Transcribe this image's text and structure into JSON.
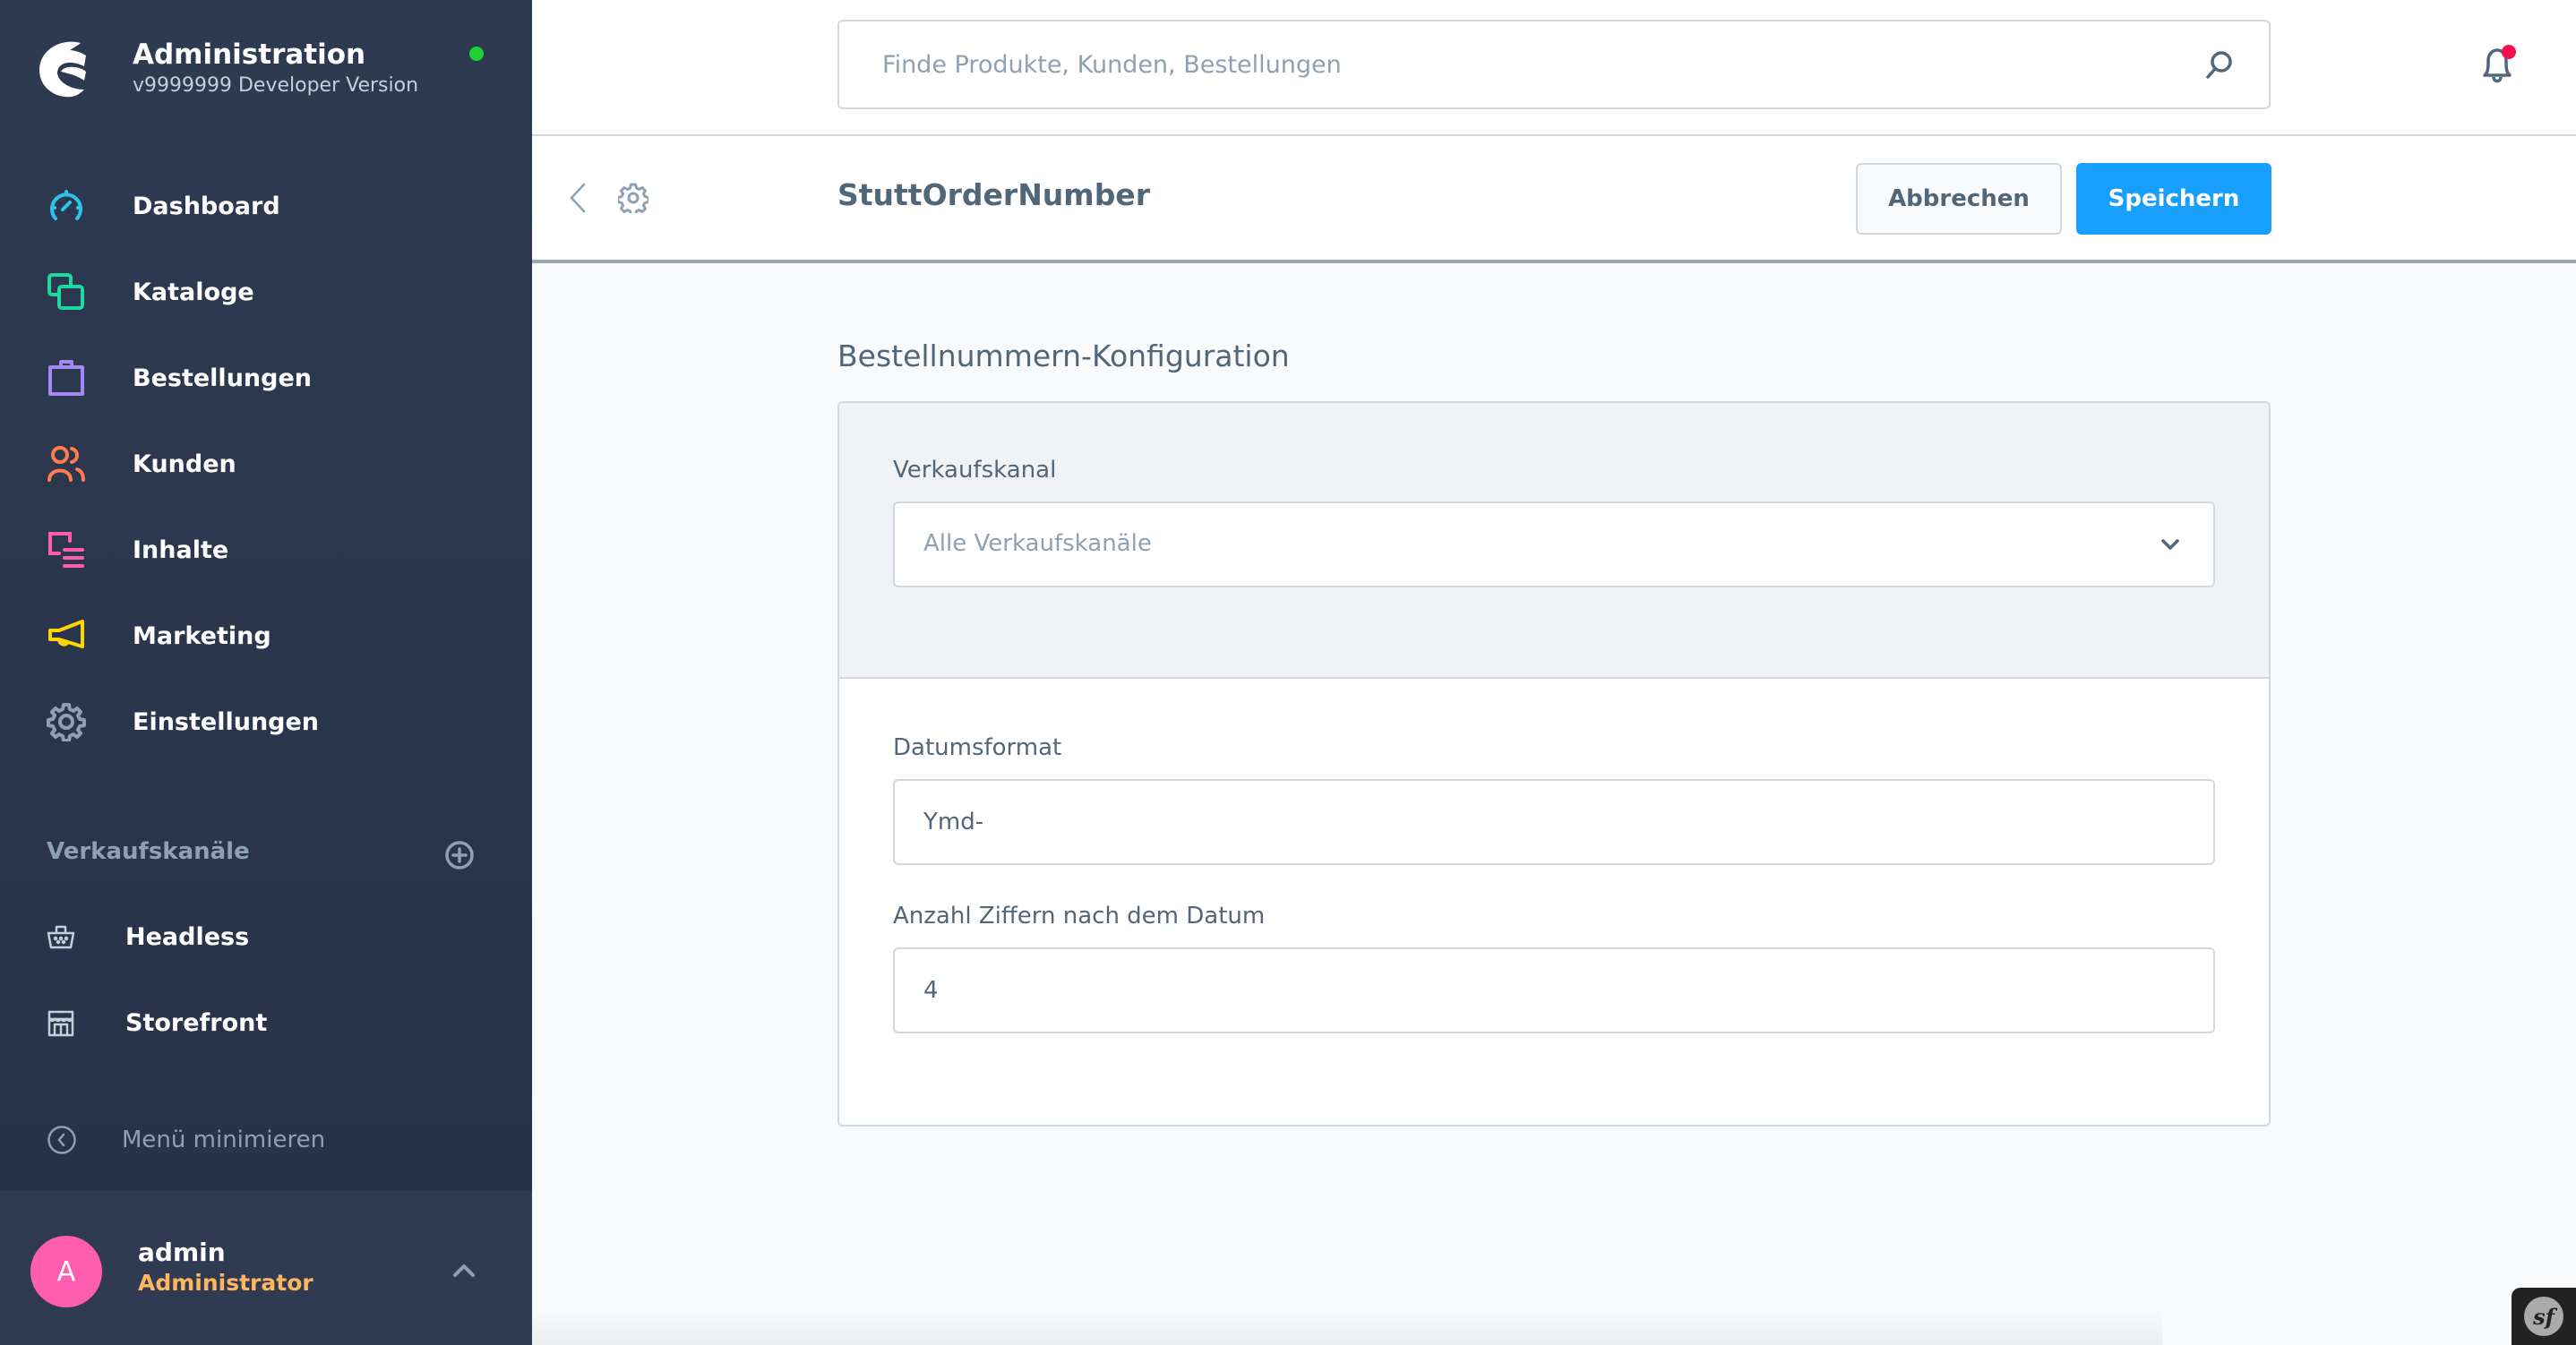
{
  "brand": {
    "title": "Administration",
    "version": "v9999999 Developer Version",
    "status_color": "#1ed236"
  },
  "sidebar": {
    "items": [
      {
        "label": "Dashboard",
        "icon": "dashboard-icon",
        "color": "#2bc5e8"
      },
      {
        "label": "Kataloge",
        "icon": "catalog-icon",
        "color": "#1fd8a0"
      },
      {
        "label": "Bestellungen",
        "icon": "orders-bag-icon",
        "color": "#a287f5"
      },
      {
        "label": "Kunden",
        "icon": "customers-icon",
        "color": "#ff7d4d"
      },
      {
        "label": "Inhalte",
        "icon": "content-icon",
        "color": "#ff5db0"
      },
      {
        "label": "Marketing",
        "icon": "megaphone-icon",
        "color": "#ffd700"
      },
      {
        "label": "Einstellungen",
        "icon": "gear-icon",
        "color": "#8ea0b3"
      }
    ],
    "sales_channels_title": "Verkaufskanäle",
    "sales_channels": [
      {
        "label": "Headless",
        "icon": "basket-icon"
      },
      {
        "label": "Storefront",
        "icon": "storefront-icon"
      }
    ],
    "minimize_label": "Menü minimieren"
  },
  "user": {
    "initial": "A",
    "name": "admin",
    "role": "Administrator",
    "avatar_color": "#ff5db0"
  },
  "topbar": {
    "search_placeholder": "Finde Produkte, Kunden, Bestellungen",
    "search_value": "",
    "notification_badge_color": "#f0104b"
  },
  "smartbar": {
    "title": "StuttOrderNumber",
    "cancel_label": "Abbrechen",
    "save_label": "Speichern",
    "accent_color": "#189eff"
  },
  "config": {
    "card_title": "Bestellnummern-Konfiguration",
    "sales_channel": {
      "label": "Verkaufskanal",
      "selected": "Alle Verkaufskanäle"
    },
    "date_format": {
      "label": "Datumsformat",
      "value": "Ymd-"
    },
    "digits": {
      "label": "Anzahl Ziffern nach dem Datum",
      "value": "4"
    }
  },
  "debug_toolbar": {
    "label": "sf"
  }
}
